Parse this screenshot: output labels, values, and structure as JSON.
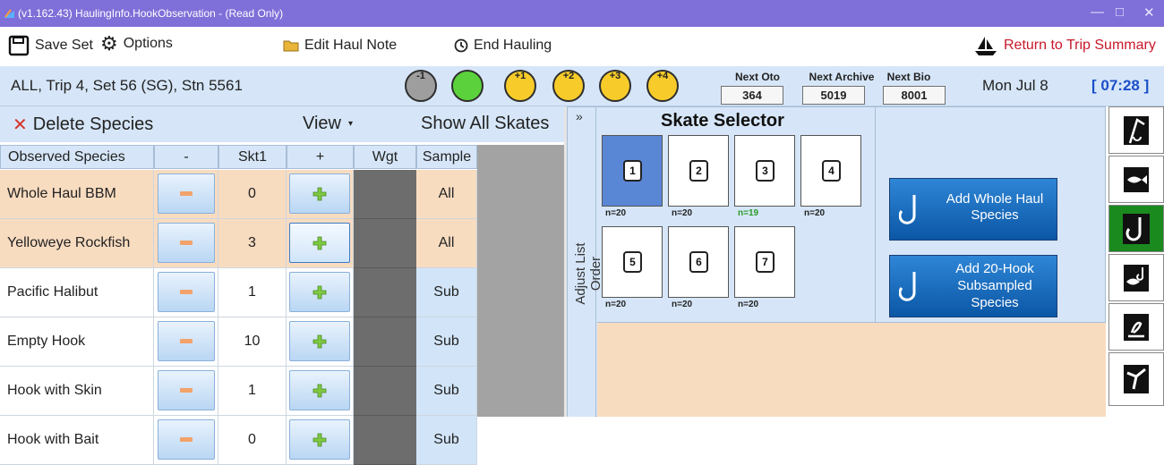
{
  "window": {
    "title": "(v1.162.43) HaulingInfo.HookObservation - (Read Only)",
    "controls": [
      "—",
      "□",
      "✕"
    ]
  },
  "toolbar": {
    "save_label": "Save Set",
    "options_label": "Options",
    "edit_note_label": "Edit Haul Note",
    "end_hauling_label": "End Hauling",
    "return_label": "Return to Trip Summary"
  },
  "status": {
    "context": "ALL, Trip 4, Set 56 (SG), Stn 5561",
    "circles": [
      {
        "label": "-1",
        "color": "#9e9e9e"
      },
      {
        "label": "",
        "color": "#5bd23c"
      },
      {
        "label": "+1",
        "color": "#f7cc2a"
      },
      {
        "label": "+2",
        "color": "#f7cc2a"
      },
      {
        "label": "+3",
        "color": "#f7cc2a"
      },
      {
        "label": "+4",
        "color": "#f7cc2a"
      }
    ],
    "next_oto_label": "Next Oto",
    "next_oto": "364",
    "next_archive_label": "Next Archive",
    "next_archive": "5019",
    "next_bio_label": "Next Bio",
    "next_bio": "8001",
    "date": "Mon Jul 8",
    "time": "[ 07:28 ]"
  },
  "species_panel": {
    "delete_label": "Delete Species",
    "view_label": "View",
    "show_all_label": "Show All Skates",
    "columns": [
      "Observed Species",
      "-",
      "Skt1",
      "+",
      "Wgt",
      "Sample"
    ],
    "rows": [
      {
        "species": "Whole Haul BBM",
        "count": "0",
        "sample": "All",
        "highlight": true
      },
      {
        "species": "Yelloweye Rockfish",
        "count": "3",
        "sample": "All",
        "highlight": true
      },
      {
        "species": "Pacific Halibut",
        "count": "1",
        "sample": "Sub",
        "highlight": false
      },
      {
        "species": "Empty Hook",
        "count": "10",
        "sample": "Sub",
        "highlight": false
      },
      {
        "species": "Hook with Skin",
        "count": "1",
        "sample": "Sub",
        "highlight": false
      },
      {
        "species": "Hook with Bait",
        "count": "0",
        "sample": "Sub",
        "highlight": false
      }
    ]
  },
  "skate_selector": {
    "collapse_label": "»",
    "adjust_label": "Adjust List Order",
    "title": "Skate Selector",
    "skates": [
      {
        "num": "1",
        "n": "n=20",
        "selected": true
      },
      {
        "num": "2",
        "n": "n=20",
        "selected": false
      },
      {
        "num": "3",
        "n": "n=19",
        "selected": false
      },
      {
        "num": "4",
        "n": "n=20",
        "selected": false
      },
      {
        "num": "5",
        "n": "n=20",
        "selected": false
      },
      {
        "num": "6",
        "n": "n=20",
        "selected": false
      },
      {
        "num": "7",
        "n": "n=20",
        "selected": false
      }
    ],
    "add_whole_label": "Add Whole Haul Species",
    "add_sub_label": "Add 20-Hook Subsampled Species"
  },
  "side_icons": [
    "hook-line-icon",
    "fish-icon",
    "hook-icon",
    "fish-on-hook-icon",
    "seabird-icon",
    "bird-flying-icon"
  ],
  "colors": {
    "title_bar": "#7f6fd8",
    "header_strip": "#d6e6f8",
    "highlight_row": "#f8dcc0",
    "sample_cell": "#d2e5f8",
    "selected_skate": "#5a86d6",
    "green_text": "#2a9a2a",
    "return_text": "#c8182a",
    "time_text": "#1b4fc8"
  }
}
